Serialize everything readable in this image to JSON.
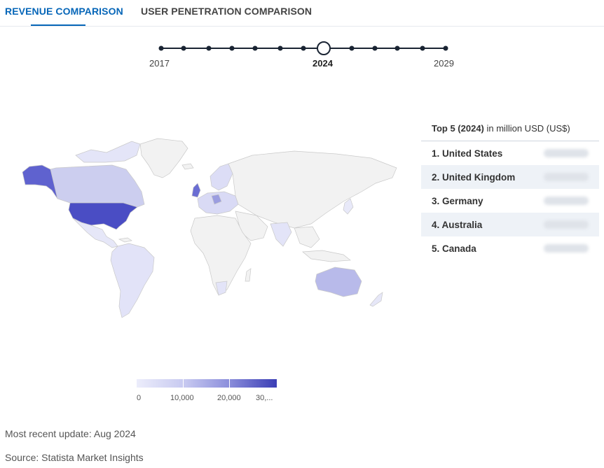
{
  "tabs": [
    {
      "label": "REVENUE COMPARISON",
      "active": true
    },
    {
      "label": "USER PENETRATION COMPARISON",
      "active": false
    }
  ],
  "timeline": {
    "start_label": "2017",
    "current_label": "2024",
    "end_label": "2029",
    "years": [
      "2017",
      "2018",
      "2019",
      "2020",
      "2021",
      "2022",
      "2023",
      "2024",
      "2025",
      "2026",
      "2027",
      "2028",
      "2029"
    ]
  },
  "top5": {
    "title_bold": "Top 5 (2024)",
    "title_rest": " in million USD (US$)",
    "items": [
      {
        "label": "1. United States"
      },
      {
        "label": "2. United Kingdom"
      },
      {
        "label": "3. Germany"
      },
      {
        "label": "4. Australia"
      },
      {
        "label": "5. Canada"
      }
    ]
  },
  "legend": {
    "ticks": [
      "0",
      "10,000",
      "20,000",
      "30,..."
    ]
  },
  "colors": {
    "accent": "#0666b8",
    "scale_low": "#ecedfb",
    "scale_high": "#3b3eb5",
    "land_default": "#f2f2f2",
    "usa": "#4a4dc4",
    "alaska": "#5f62cf",
    "uk": "#6a6dd3",
    "canada": "#ccceef",
    "australia": "#b8baea"
  },
  "footer": {
    "update": "Most recent update: Aug 2024",
    "source": "Source: Statista Market Insights"
  }
}
